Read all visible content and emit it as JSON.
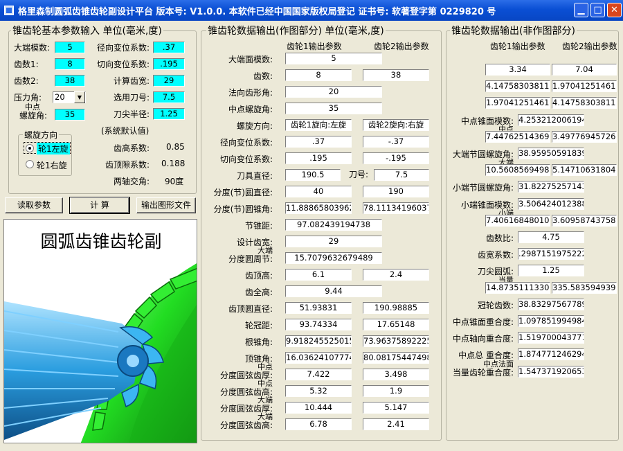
{
  "titlebar": {
    "title": "格里森制圆弧齿锥齿轮副设计平台  版本号: V1.0.0.  本软件已经中国国家版权局登记  证书号: 软著登字第 0229820 号",
    "min_icon": "minimize-icon",
    "max_icon": "maximize-icon",
    "close_icon": "close-icon"
  },
  "input_group": {
    "title": "锥齿轮基本参数输入 单位(毫米,度)",
    "module_label": "大端模数:",
    "module_value": "5",
    "z1_label": "齿数1:",
    "z1_value": "8",
    "z2_label": "齿数2:",
    "z2_value": "38",
    "pressure_label": "压力角:",
    "pressure_value": "20",
    "spiral_label_1": "中点",
    "spiral_label_2": "螺旋角:",
    "spiral_value": "35",
    "radial_shift_label": "径向变位系数:",
    "radial_shift_value": ".37",
    "tangential_shift_label": "切向变位系数:",
    "tangential_shift_value": ".195",
    "face_width_label": "计算齿宽:",
    "face_width_value": "29",
    "cutter_label": "选用刀号:",
    "cutter_value": "7.5",
    "tip_radius_label": "刀尖半径:",
    "tip_radius_value": "1.25",
    "defaults_label": "(系统默认值)",
    "addendum_coef_label": "齿高系数:",
    "addendum_coef_value": "0.85",
    "clearance_coef_label": "齿顶隙系数:",
    "clearance_coef_value": "0.188",
    "shaft_angle_label": "两轴交角:",
    "shaft_angle_value": "90度",
    "helix_group_title": "螺旋方向",
    "helix_left": "轮1左旋",
    "helix_right": "轮1右旋"
  },
  "buttons": {
    "read": "读取参数",
    "calc": "计  算",
    "export": "输出图形文件"
  },
  "picture": {
    "title": "圆弧齿锥齿轮副"
  },
  "drawing_group": {
    "title": "锥齿轮数据输出(作图部分) 单位(毫米,度)",
    "col1": "齿轮1输出参数",
    "col2": "齿轮2输出参数",
    "rows": [
      {
        "l1": "",
        "l2": "大端面模数:",
        "v1": "5",
        "v2": null
      },
      {
        "l1": "",
        "l2": "齿数:",
        "v1": "8",
        "v2": "38"
      },
      {
        "l1": "",
        "l2": "法向齿形角:",
        "v1": "20",
        "v2": null
      },
      {
        "l1": "",
        "l2": "中点螺旋角:",
        "v1": "35",
        "v2": null
      },
      {
        "l1": "",
        "l2": "螺旋方向:",
        "v1": "齿轮1旋向:左旋",
        "v2": "齿轮2旋向:右旋"
      },
      {
        "l1": "",
        "l2": "径向变位系数:",
        "v1": ".37",
        "v2": "-.37"
      },
      {
        "l1": "",
        "l2": "切向变位系数:",
        "v1": ".195",
        "v2": "-.195"
      },
      {
        "l1": "",
        "l2": "刀具直径:",
        "v1": "190.5",
        "v2": "7.5"
      },
      {
        "l1": "",
        "l2": "分度(节)圆直径:",
        "v1": "40",
        "v2": "190"
      },
      {
        "l1": "",
        "l2": "分度(节)圆锥角:",
        "v1": "11.888658039628",
        "v2": "78.111341960372"
      },
      {
        "l1": "",
        "l2": "节锥距:",
        "v1": "97.082439194738",
        "v2": null
      },
      {
        "l1": "",
        "l2": "设计齿宽:",
        "v1": "29",
        "v2": null
      },
      {
        "l1": "大端",
        "l2": "分度圆周节:",
        "v1": "15.7079632679489",
        "v2": null
      },
      {
        "l1": "",
        "l2": "齿顶高:",
        "v1": "6.1",
        "v2": "2.4"
      },
      {
        "l1": "",
        "l2": "齿全高:",
        "v1": "9.44",
        "v2": null
      },
      {
        "l1": "",
        "l2": "齿顶圆直径:",
        "v1": "51.93831",
        "v2": "190.98885"
      },
      {
        "l1": "",
        "l2": "轮冠距:",
        "v1": "93.74334",
        "v2": "17.65148"
      },
      {
        "l1": "",
        "l2": "根锥角:",
        "v1": "9.9182455250156",
        "v2": "73.963758922255"
      },
      {
        "l1": "",
        "l2": "顶锥角:",
        "v1": "16.036241077744",
        "v2": "80.081754474984"
      },
      {
        "l1": "中点",
        "l2": "分度圆弦齿厚:",
        "v1": "7.422",
        "v2": "3.498"
      },
      {
        "l1": "中点",
        "l2": "分度圆弦齿高:",
        "v1": "5.32",
        "v2": "1.9"
      },
      {
        "l1": "大端",
        "l2": "分度圆弦齿厚:",
        "v1": "10.444",
        "v2": "5.147"
      },
      {
        "l1": "大端",
        "l2": "分度圆弦齿高:",
        "v1": "6.78",
        "v2": "2.41"
      }
    ],
    "cutter_no_label": "刀号:"
  },
  "nondrawing_group": {
    "title": "锥齿轮数据输出(非作图部分)",
    "col1": "齿轮1输出参数",
    "col2": "齿轮2输出参数",
    "rows": [
      {
        "l1": "",
        "l2": "齿根高:",
        "v1": "3.34",
        "v2": "7.04"
      },
      {
        "l1": "",
        "l2": "齿顶角:",
        "v1": "4.1475830381167",
        "v2": "1.9704125146123"
      },
      {
        "l1": "",
        "l2": "齿根角:",
        "v1": "1.9704125146123",
        "v2": "4.1475830381167"
      },
      {
        "l1": "",
        "l2": "中点锥面模数:",
        "v1": "4.2532120061943",
        "v2": null
      },
      {
        "l1": "中点",
        "l2": "弧齿厚:",
        "v1": "7.4476251436943",
        "v2": "3.4977694572666"
      },
      {
        "l1": "",
        "l2": "大端节圆螺旋角:",
        "v1": "38.959505918394",
        "v2": null
      },
      {
        "l1": "大端",
        "l2": "弧齿厚:",
        "v1": "10.560856949899",
        "v2": "5.1471063180498"
      },
      {
        "l1": "",
        "l2": "小端节圆螺旋角:",
        "v1": "31.822752571435",
        "v2": null
      },
      {
        "l1": "",
        "l2": "小端锥面模数:",
        "v1": "3.5064240123886",
        "v2": null
      },
      {
        "l1": "小端",
        "l2": "弧齿厚:",
        "v1": "7.4061684801055",
        "v2": "3.6095874375854"
      },
      {
        "l1": "",
        "l2": "齿数比:",
        "v1": "4.75",
        "v2": null
      },
      {
        "l1": "",
        "l2": "齿宽系数:",
        "v1": ".29871519752227",
        "v2": null
      },
      {
        "l1": "",
        "l2": "刀尖圆弧:",
        "v1": "1.25",
        "v2": null
      },
      {
        "l1": "当量",
        "l2": "齿数:",
        "v1": "14.873511133066",
        "v2": "335.58359493981"
      },
      {
        "l1": "",
        "l2": "冠轮齿数:",
        "v1": "38.832975677895",
        "v2": null
      },
      {
        "l1": "",
        "l2": "中点锥面重合度:",
        "v1": "1.0978519949846",
        "v2": null
      },
      {
        "l1": "",
        "l2": "中点轴向重合度:",
        "v1": "1.5197000437718",
        "v2": null
      },
      {
        "l1": "",
        "l2": "中点总  重合度:",
        "v1": "1.8747712462943",
        "v2": null
      },
      {
        "l1": "中点法面",
        "l2": "当量齿轮重合度:",
        "v1": "1.5473719206530",
        "v2": null
      }
    ]
  },
  "colors": {
    "title_blue": "#0a4fd4",
    "input_cyan": "#00ffff",
    "window_bg": "#ece9d8",
    "gear_green": "#22dd22",
    "pinion_blue": "#2a9ddf"
  }
}
